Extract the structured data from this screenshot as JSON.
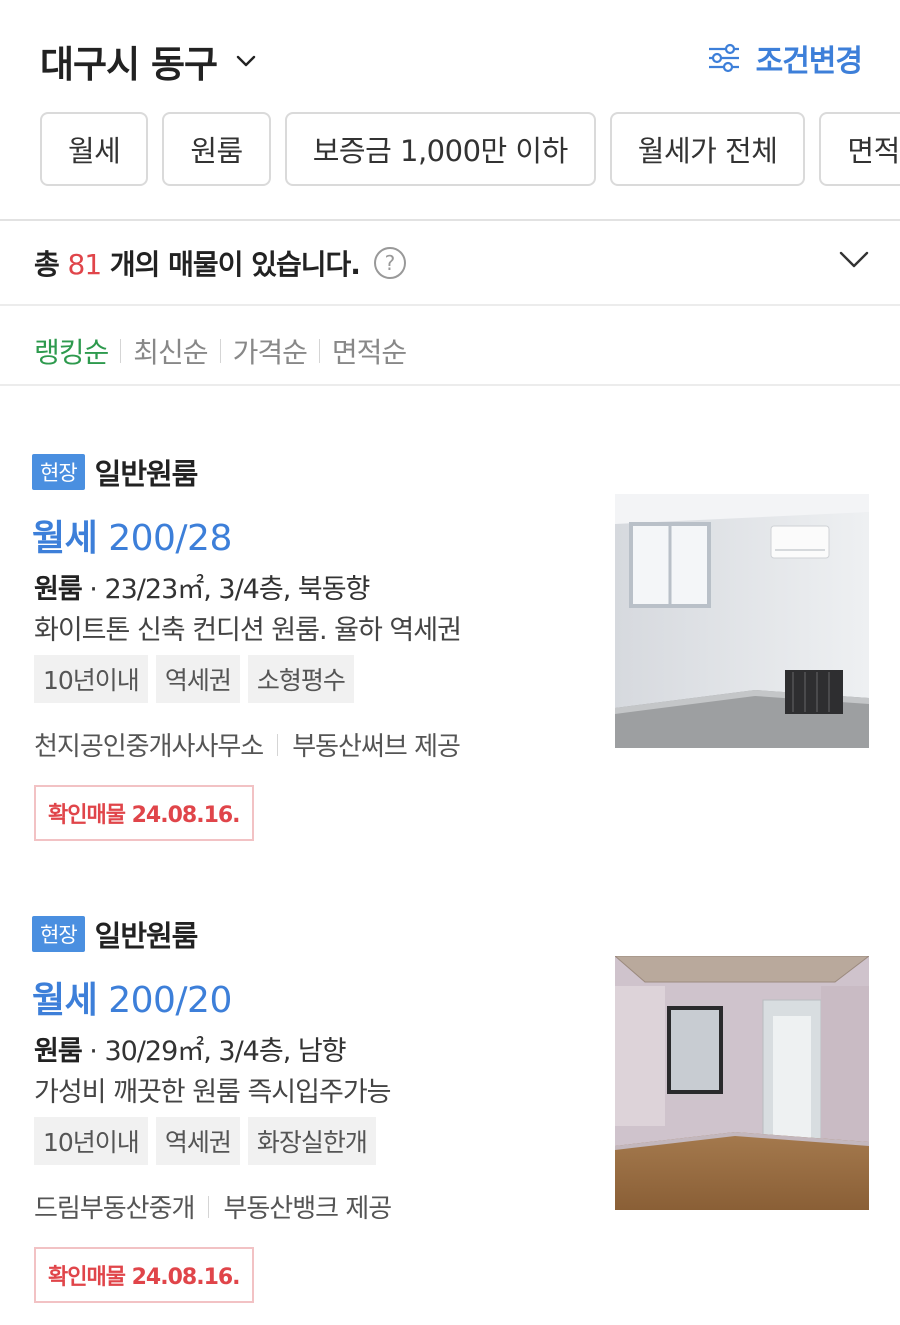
{
  "header": {
    "location": "대구시 동구",
    "condition_label": "조건변경"
  },
  "filters": [
    "월세",
    "원룸",
    "보증금 1,000만 이하",
    "월세가 전체",
    "면적"
  ],
  "summary": {
    "prefix": "총 ",
    "count": "81",
    "suffix": " 개의 매물이 있습니다.",
    "help": "?"
  },
  "sort": {
    "items": [
      "랭킹순",
      "최신순",
      "가격순",
      "면적순"
    ],
    "active": "랭킹순"
  },
  "listings": [
    {
      "badge": "현장",
      "type": "일반원룸",
      "price_kind": "월세",
      "price_value": "200/28",
      "room": "원룸",
      "spec": "23/23㎡, 3/4층, 북동향",
      "description": "화이트톤 신축 컨디션 원룸. 율하 역세권",
      "tags": [
        "10년이내",
        "역세권",
        "소형평수"
      ],
      "agency": "천지공인중개사사무소",
      "provider": "부동산써브 제공",
      "verified": "확인매물 24.08.16."
    },
    {
      "badge": "현장",
      "type": "일반원룸",
      "price_kind": "월세",
      "price_value": "200/20",
      "room": "원룸",
      "spec": "30/29㎡, 3/4층, 남향",
      "description": "가성비 깨끗한 원룸 즉시입주가능",
      "tags": [
        "10년이내",
        "역세권",
        "화장실한개"
      ],
      "agency": "드림부동산중개",
      "provider": "부동산뱅크 제공",
      "verified": "확인매물 24.08.16."
    }
  ],
  "colors": {
    "accent_blue": "#3d7fd9",
    "active_sort_green": "#2e9a4e",
    "count_red": "#e0454a",
    "badge_blue": "#4a8fe0"
  },
  "icons": [
    "chevron-down-icon",
    "sliders-icon",
    "help-icon",
    "room-photo"
  ]
}
